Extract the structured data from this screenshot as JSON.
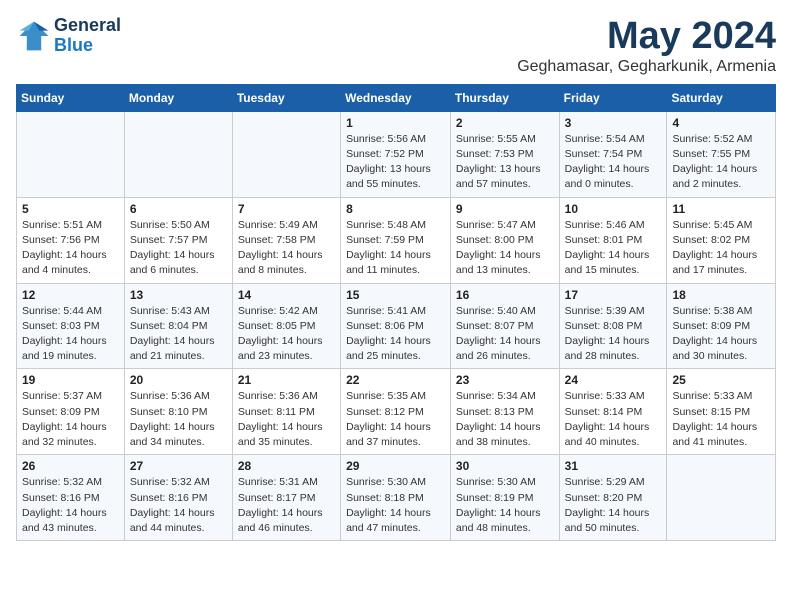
{
  "header": {
    "logo_general": "General",
    "logo_blue": "Blue",
    "month": "May 2024",
    "location": "Geghamasar, Gegharkunik, Armenia"
  },
  "columns": [
    "Sunday",
    "Monday",
    "Tuesday",
    "Wednesday",
    "Thursday",
    "Friday",
    "Saturday"
  ],
  "weeks": [
    {
      "days": [
        {
          "num": "",
          "info": ""
        },
        {
          "num": "",
          "info": ""
        },
        {
          "num": "",
          "info": ""
        },
        {
          "num": "1",
          "info": "Sunrise: 5:56 AM\nSunset: 7:52 PM\nDaylight: 13 hours\nand 55 minutes."
        },
        {
          "num": "2",
          "info": "Sunrise: 5:55 AM\nSunset: 7:53 PM\nDaylight: 13 hours\nand 57 minutes."
        },
        {
          "num": "3",
          "info": "Sunrise: 5:54 AM\nSunset: 7:54 PM\nDaylight: 14 hours\nand 0 minutes."
        },
        {
          "num": "4",
          "info": "Sunrise: 5:52 AM\nSunset: 7:55 PM\nDaylight: 14 hours\nand 2 minutes."
        }
      ]
    },
    {
      "days": [
        {
          "num": "5",
          "info": "Sunrise: 5:51 AM\nSunset: 7:56 PM\nDaylight: 14 hours\nand 4 minutes."
        },
        {
          "num": "6",
          "info": "Sunrise: 5:50 AM\nSunset: 7:57 PM\nDaylight: 14 hours\nand 6 minutes."
        },
        {
          "num": "7",
          "info": "Sunrise: 5:49 AM\nSunset: 7:58 PM\nDaylight: 14 hours\nand 8 minutes."
        },
        {
          "num": "8",
          "info": "Sunrise: 5:48 AM\nSunset: 7:59 PM\nDaylight: 14 hours\nand 11 minutes."
        },
        {
          "num": "9",
          "info": "Sunrise: 5:47 AM\nSunset: 8:00 PM\nDaylight: 14 hours\nand 13 minutes."
        },
        {
          "num": "10",
          "info": "Sunrise: 5:46 AM\nSunset: 8:01 PM\nDaylight: 14 hours\nand 15 minutes."
        },
        {
          "num": "11",
          "info": "Sunrise: 5:45 AM\nSunset: 8:02 PM\nDaylight: 14 hours\nand 17 minutes."
        }
      ]
    },
    {
      "days": [
        {
          "num": "12",
          "info": "Sunrise: 5:44 AM\nSunset: 8:03 PM\nDaylight: 14 hours\nand 19 minutes."
        },
        {
          "num": "13",
          "info": "Sunrise: 5:43 AM\nSunset: 8:04 PM\nDaylight: 14 hours\nand 21 minutes."
        },
        {
          "num": "14",
          "info": "Sunrise: 5:42 AM\nSunset: 8:05 PM\nDaylight: 14 hours\nand 23 minutes."
        },
        {
          "num": "15",
          "info": "Sunrise: 5:41 AM\nSunset: 8:06 PM\nDaylight: 14 hours\nand 25 minutes."
        },
        {
          "num": "16",
          "info": "Sunrise: 5:40 AM\nSunset: 8:07 PM\nDaylight: 14 hours\nand 26 minutes."
        },
        {
          "num": "17",
          "info": "Sunrise: 5:39 AM\nSunset: 8:08 PM\nDaylight: 14 hours\nand 28 minutes."
        },
        {
          "num": "18",
          "info": "Sunrise: 5:38 AM\nSunset: 8:09 PM\nDaylight: 14 hours\nand 30 minutes."
        }
      ]
    },
    {
      "days": [
        {
          "num": "19",
          "info": "Sunrise: 5:37 AM\nSunset: 8:09 PM\nDaylight: 14 hours\nand 32 minutes."
        },
        {
          "num": "20",
          "info": "Sunrise: 5:36 AM\nSunset: 8:10 PM\nDaylight: 14 hours\nand 34 minutes."
        },
        {
          "num": "21",
          "info": "Sunrise: 5:36 AM\nSunset: 8:11 PM\nDaylight: 14 hours\nand 35 minutes."
        },
        {
          "num": "22",
          "info": "Sunrise: 5:35 AM\nSunset: 8:12 PM\nDaylight: 14 hours\nand 37 minutes."
        },
        {
          "num": "23",
          "info": "Sunrise: 5:34 AM\nSunset: 8:13 PM\nDaylight: 14 hours\nand 38 minutes."
        },
        {
          "num": "24",
          "info": "Sunrise: 5:33 AM\nSunset: 8:14 PM\nDaylight: 14 hours\nand 40 minutes."
        },
        {
          "num": "25",
          "info": "Sunrise: 5:33 AM\nSunset: 8:15 PM\nDaylight: 14 hours\nand 41 minutes."
        }
      ]
    },
    {
      "days": [
        {
          "num": "26",
          "info": "Sunrise: 5:32 AM\nSunset: 8:16 PM\nDaylight: 14 hours\nand 43 minutes."
        },
        {
          "num": "27",
          "info": "Sunrise: 5:32 AM\nSunset: 8:16 PM\nDaylight: 14 hours\nand 44 minutes."
        },
        {
          "num": "28",
          "info": "Sunrise: 5:31 AM\nSunset: 8:17 PM\nDaylight: 14 hours\nand 46 minutes."
        },
        {
          "num": "29",
          "info": "Sunrise: 5:30 AM\nSunset: 8:18 PM\nDaylight: 14 hours\nand 47 minutes."
        },
        {
          "num": "30",
          "info": "Sunrise: 5:30 AM\nSunset: 8:19 PM\nDaylight: 14 hours\nand 48 minutes."
        },
        {
          "num": "31",
          "info": "Sunrise: 5:29 AM\nSunset: 8:20 PM\nDaylight: 14 hours\nand 50 minutes."
        },
        {
          "num": "",
          "info": ""
        }
      ]
    }
  ]
}
